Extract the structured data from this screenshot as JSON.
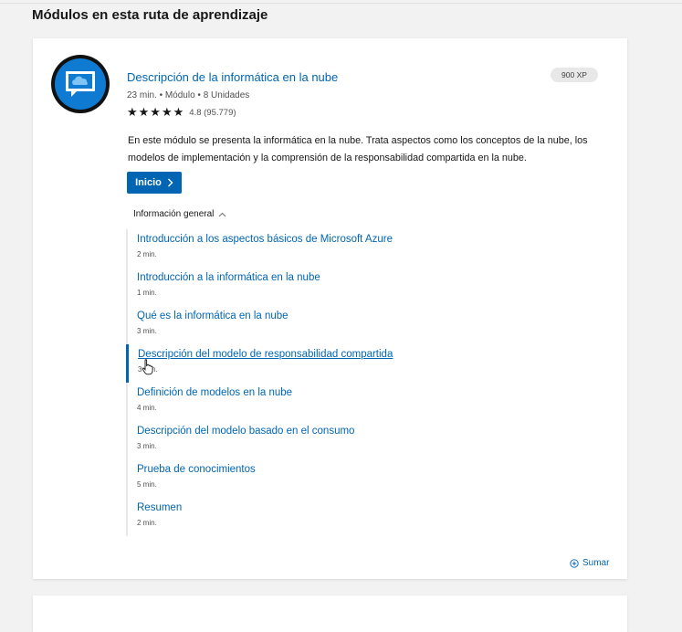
{
  "page": {
    "section_heading": "Módulos en esta ruta de aprendizaje"
  },
  "module": {
    "title": "Descripción de la informática en la nube",
    "meta": "23 min. • Módulo • 8 Unidades",
    "rating": {
      "stars": "★★★★★",
      "text": "4.8 (95.779)",
      "value": 4.8
    },
    "xp": "900 XP",
    "description": "En este módulo se presenta la informática en la nube. Trata aspectos como los conceptos de la nube, los modelos de implementación y la comprensión de la responsabilidad compartida en la nube.",
    "start_button": "Inicio",
    "overview_label": "Información general",
    "add_label": "Sumar",
    "icon": "cloud-chat-icon",
    "accent_color": "#0065b3"
  },
  "units": [
    {
      "title": "Introducción a los aspectos básicos de Microsoft Azure",
      "duration": "2 min."
    },
    {
      "title": "Introducción a la informática en la nube",
      "duration": "1 min."
    },
    {
      "title": "Qué es la informática en la nube",
      "duration": "3 min."
    },
    {
      "title": "Descripción del modelo de responsabilidad compartida",
      "duration": "3 min."
    },
    {
      "title": "Definición de modelos en la nube",
      "duration": "4 min."
    },
    {
      "title": "Descripción del modelo basado en el consumo",
      "duration": "3 min."
    },
    {
      "title": "Prueba de conocimientos",
      "duration": "5 min."
    },
    {
      "title": "Resumen",
      "duration": "2 min."
    }
  ]
}
